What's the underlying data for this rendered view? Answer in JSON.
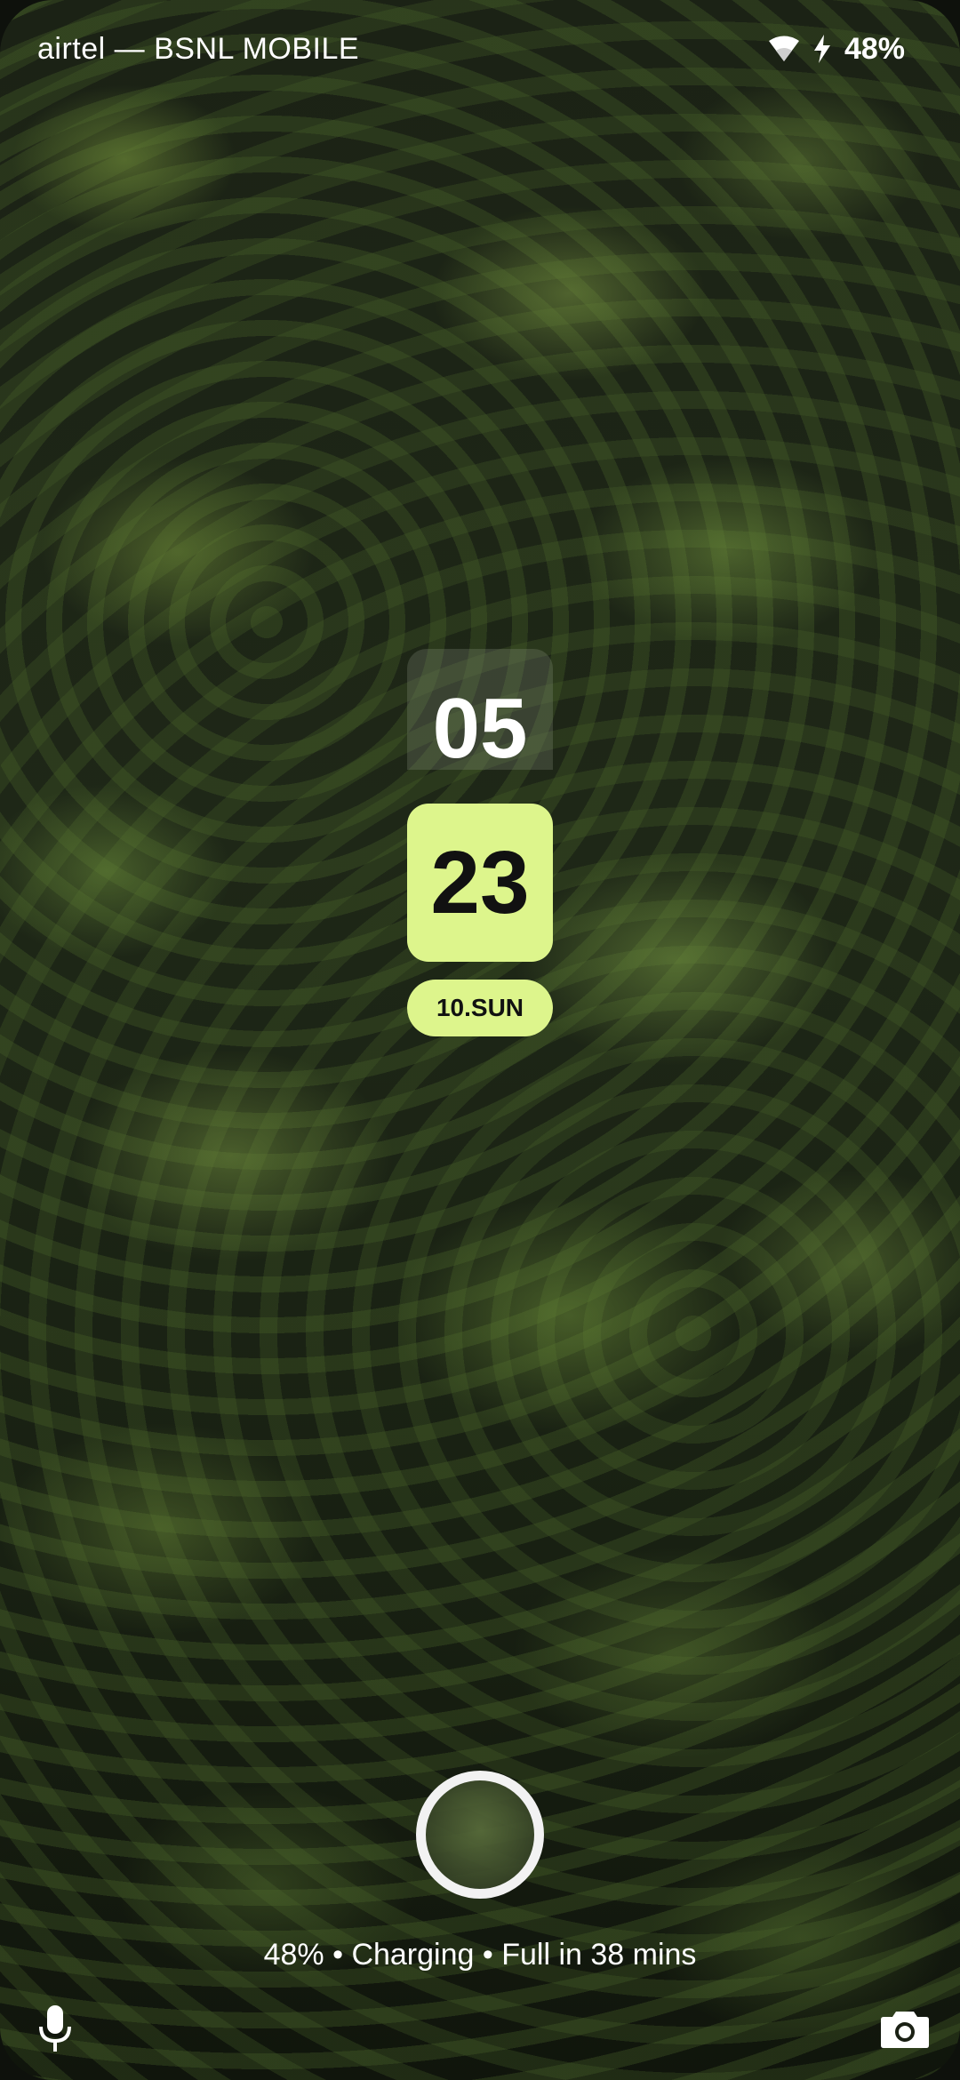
{
  "status_bar": {
    "carrier": "airtel — BSNL MOBILE",
    "battery": "48%",
    "wifi_icon": "wifi-icon",
    "charging_icon": "bolt-icon"
  },
  "clock": {
    "hour": "05",
    "minute": "23",
    "date": "10.SUN"
  },
  "lock": {
    "charging_text": "48% • Charging • Full in 38 mins",
    "fingerprint_icon": "fingerprint-icon",
    "left_shortcut_icon": "microphone-icon",
    "right_shortcut_icon": "camera-icon"
  },
  "colors": {
    "accent": "#ddf58c",
    "text": "#ffffff"
  }
}
